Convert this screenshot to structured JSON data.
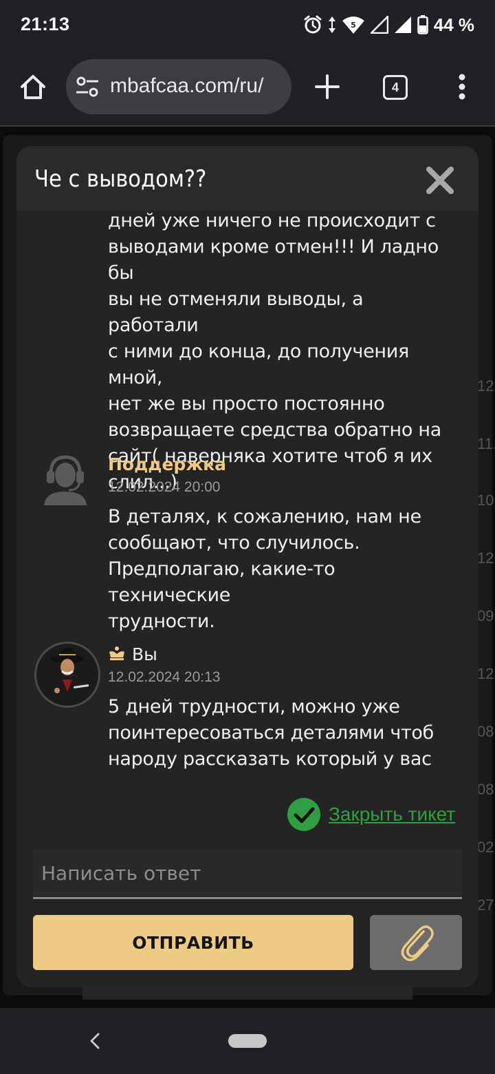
{
  "status_bar": {
    "time": "21:13",
    "battery_text": "44 %",
    "icons": [
      "alarm-icon",
      "data-arrows-icon",
      "wifi-icon",
      "signal-icon",
      "signal-icon",
      "battery-icon"
    ],
    "wifi_badge": "5"
  },
  "browser": {
    "url": "mbafcaa.com/ru/",
    "tab_count": "4",
    "icons": [
      "home-icon",
      "site-settings-icon",
      "plus-icon",
      "tabs-icon",
      "more-vert-icon"
    ]
  },
  "background_page": {
    "dates": [
      "12.",
      "11.",
      "10.",
      "12.",
      "09.",
      "12.",
      "08.",
      "08.",
      "02.",
      "27."
    ]
  },
  "modal": {
    "title": "Че с выводом??",
    "close_icon": "close-icon",
    "messages": [
      {
        "author": "",
        "time": "",
        "lines": [
          "дней уже ничего не происходит с",
          "выводами кроме отмен!!! И ладно бы",
          "вы не отменяли выводы, а работали",
          "с ними до конца, до получения мной,",
          "нет же вы просто постоянно",
          "возвращаете средства обратно на",
          "сайт( наверняка хотите чтоб я их",
          "слил...)"
        ]
      },
      {
        "author": "Поддержка",
        "time": "12.02.2024 20:00",
        "avatar": "support-agent-icon",
        "lines": [
          "В деталях, к сожалению, нам не",
          "сообщают, что случилось.",
          "Предполагаю, какие-то технические",
          "трудности."
        ]
      },
      {
        "author": "Вы",
        "time": "12.02.2024 20:13",
        "avatar": "user-avatar",
        "badge_icon": "crown-icon",
        "lines": [
          "5 дней трудности, можно уже",
          "поинтересоваться деталями чтоб",
          "народу рассказать который у вас"
        ]
      }
    ],
    "close_ticket_label": "Закрыть тикет",
    "reply_placeholder": "Написать ответ",
    "send_label": "ОТПРАВИТЬ",
    "attach_icon": "paperclip-icon"
  },
  "colors": {
    "accent_gold": "#eecb85",
    "support_name": "#eecb85",
    "success_green": "#2ea043",
    "modal_bg": "#242424"
  },
  "nav_bar": {
    "icons": [
      "back-icon",
      "home-pill"
    ]
  }
}
